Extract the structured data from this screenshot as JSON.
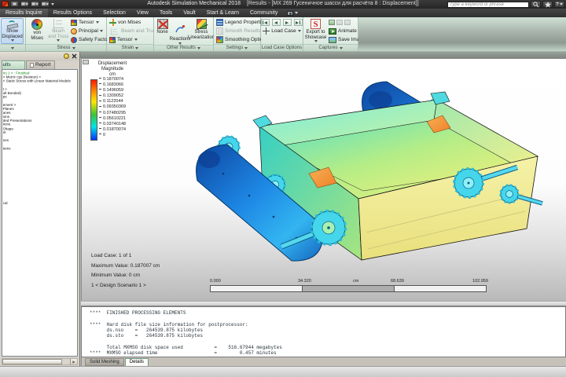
{
  "title_bar": {
    "app_title": "Autodesk Simulation Mechanical 2018",
    "doc_title": "[Results - [MX 269 Гусеничное шасси для расчёта 8 : Displacement]]",
    "search_placeholder": "Type a keyword or phrase"
  },
  "icons": {
    "help_glyph": "?",
    "export_showcase_glyph": "S"
  },
  "menu_tabs": [
    "Results Inquire",
    "Results Options",
    "Selection",
    "View",
    "Tools",
    "Vault",
    "Start & Learn",
    "Community"
  ],
  "ribbon": {
    "show_displaced": {
      "label": "Show\nDisplaced"
    },
    "stress": {
      "label": "Stress",
      "von_mises": "von\nMises",
      "beam_truss": "Beam\nand Truss",
      "tensor": "Tensor",
      "principal": "Principal",
      "safety_factor": "Safety Factor"
    },
    "strain": {
      "label": "Strain",
      "von_mises": "von Mises",
      "beam_truss": "Beam and Truss",
      "tensor": "Tensor"
    },
    "other": {
      "label": "Other Results",
      "none": "None",
      "reactions": "Reactions",
      "stress_lin": "Stress\nLinearization"
    },
    "settings": {
      "label": "Settings",
      "legend_props": "Legend Properties",
      "smooth": "Smooth Results",
      "smoothing": "Smoothing Options"
    },
    "load_case": {
      "label": "Load Case Options",
      "button": "Load Case"
    },
    "captures": {
      "label": "Captures",
      "export": "Export to\nShowcase",
      "animate": "Animate",
      "save_image": "Save Image"
    }
  },
  "browser": {
    "tab_results": "Results",
    "tab_report": "Report",
    "status_item": "rio 1 > : Finished",
    "items": [
      "< Metric cgs (Newton) >",
      "< Static Stress with Linear Material Models",
      "",
      "t >",
      "ult Bonded)",
      "ps",
      "",
      "ement >",
      "Planes",
      "anes",
      "ions",
      "ded Presentations",
      "tions",
      "Shape",
      "nt",
      "",
      "nes",
      "",
      "tems"
    ],
    "far_item": "cal"
  },
  "legend": {
    "title": "Displacement",
    "subtitle": "Magnitude",
    "unit": "cm",
    "values": [
      "0.1870074",
      "0.1683066",
      "0.1496059",
      "0.1309052",
      "0.1122044",
      "0.09350369",
      "0.07480295",
      "0.05610221",
      "0.03740148",
      "0.01870074",
      "0"
    ]
  },
  "viewport_info": {
    "load_case": "Load Case:  1 of 1",
    "max_value": "Maximum Value: 0.187007 cm",
    "min_value": "Minimum Value: 0 cm",
    "scenario": "1 < Design Scenario 1 >"
  },
  "ruler": {
    "labels": [
      "0.000",
      "34.320",
      "68.639",
      "102.959"
    ],
    "unit": "cm"
  },
  "log": {
    "text": "****  FINISHED PROCESSING ELEMENTS\n\n****  Hard disk file size information for postprocessor:\n      ds.nso    =   264539.875 kilobytes\n      ds.sto    =   264539.875 kilobytes\n\n      Total MXMSO disk space used           =    516.67944 megabytes\n****  MXMSO elapsed time                    =        0.457 minutes\n\n****  The TOTAL elapsed time                =        2.617 minutes"
  },
  "bottom_tabs": {
    "solid_meshing": "Solid Meshing",
    "details": "Details"
  },
  "colors": {
    "title_bar": "#2e2e2e",
    "ribbon_bg": "#d9e9de",
    "legend_max": "#ff1a00",
    "legend_min": "#0033ff",
    "model_track_blue": "#1a7ad4",
    "model_body_yellow": "#f0ee9a",
    "finished_status_green": "#128a12",
    "showcase_red": "#c81e12"
  }
}
